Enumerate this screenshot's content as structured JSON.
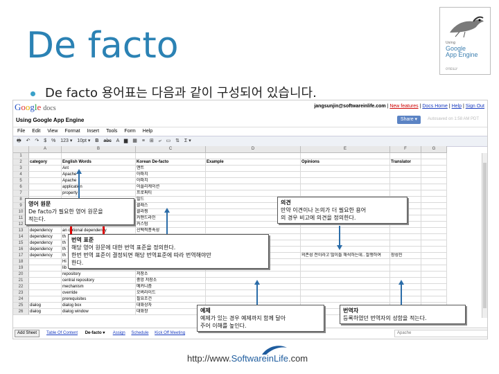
{
  "slide": {
    "title": "De facto",
    "bullet": "De facto 용어표는 다음과 같이 구성되어 있습니다.",
    "footer_url_prefix": "http://www.",
    "footer_url_brand": "SoftwareinLife",
    "footer_url_suffix": ".com"
  },
  "book": {
    "small": "Using",
    "title_line1": "Google",
    "title_line2": "App Engine",
    "publisher": "O'REILLY"
  },
  "app": {
    "logo_google": "Google",
    "logo_docs": "docs",
    "user": "jangsunjin@softwareinlife.com",
    "links": [
      "New features",
      "Docs Home",
      "Help",
      "Sign Out"
    ],
    "doc_title": "Using Google App Engine",
    "share_label": "Share ▾",
    "saved_text": "Autosaved on 1:58 AM PDT",
    "menu": [
      "File",
      "Edit",
      "View",
      "Format",
      "Insert",
      "Tools",
      "Form",
      "Help"
    ],
    "toolbar": {
      "currency": "$",
      "percent": "%",
      "number_format": "123 ▾",
      "font_size": "10pt ▾",
      "bold": "B",
      "strike": "abc",
      "sum": "Σ ▾"
    },
    "columns": [
      "A",
      "B",
      "C",
      "D",
      "E",
      "F",
      "G",
      "H"
    ],
    "rows": [
      {
        "n": "1",
        "b": "",
        "c": "",
        "d": "",
        "e": "",
        "f": "",
        "g": ""
      },
      {
        "n": "2",
        "b": "category",
        "c": "English Words",
        "d": "Korean De-facto",
        "e": "Example",
        "f": "Opinions",
        "g": "Translator",
        "bold": true
      },
      {
        "n": "3",
        "b": "",
        "c": "Ant",
        "d": "앤트",
        "e": "",
        "f": "",
        "g": ""
      },
      {
        "n": "4",
        "b": "",
        "c": "Apache",
        "d": "아파치",
        "e": "",
        "f": "",
        "g": ""
      },
      {
        "n": "5",
        "b": "",
        "c": "Apache",
        "d": "아파치",
        "e": "",
        "f": "",
        "g": ""
      },
      {
        "n": "6",
        "b": "",
        "c": "application",
        "d": "어플리케이션",
        "e": "",
        "f": "",
        "g": ""
      },
      {
        "n": "7",
        "b": "",
        "c": "property",
        "d": "프로퍼티",
        "e": "",
        "f": "",
        "g": ""
      },
      {
        "n": "8",
        "b": "",
        "c": "",
        "d": "빌드",
        "e": "",
        "f": "",
        "g": ""
      },
      {
        "n": "9",
        "b": "",
        "c": "",
        "d": "클래스",
        "e": "",
        "f": "",
        "g": ""
      },
      {
        "n": "10",
        "b": "",
        "c": "",
        "d": "클라찡",
        "e": "",
        "f": "",
        "g": ""
      },
      {
        "n": "11",
        "b": "",
        "c": "",
        "d": "커맨드라인",
        "e": "",
        "f": "",
        "g": ""
      },
      {
        "n": "12",
        "b": "",
        "c": "custom",
        "d": "커스텀",
        "e": "",
        "f": "",
        "g": ""
      },
      {
        "n": "13",
        "b": "dependency",
        "c": "an optional dependency",
        "d": "선택적종속성",
        "e": "",
        "f": "",
        "g": ""
      },
      {
        "n": "14",
        "b": "dependency",
        "c": "th",
        "d": "",
        "e": "",
        "f": "",
        "g": ""
      },
      {
        "n": "15",
        "b": "dependency",
        "c": "th",
        "d": "",
        "e": "",
        "f": "",
        "g": ""
      },
      {
        "n": "16",
        "b": "dependency",
        "c": "th",
        "d": "",
        "e": "",
        "f": "",
        "g": ""
      },
      {
        "n": "17",
        "b": "dependency",
        "c": "th",
        "d": "",
        "e": "",
        "f": "의존성 전이라고 많이들 해석하는데.. 잘쟁하여",
        "g": "장성진"
      },
      {
        "n": "18",
        "b": "",
        "c": "Hi",
        "d": "",
        "e": "",
        "f": "",
        "g": ""
      },
      {
        "n": "19",
        "b": "",
        "c": "lib",
        "d": "",
        "e": "",
        "f": "",
        "g": ""
      },
      {
        "n": "20",
        "b": "",
        "c": "repository",
        "d": "저장소",
        "e": "",
        "f": "",
        "g": ""
      },
      {
        "n": "21",
        "b": "",
        "c": "central repository",
        "d": "중앙 저장소",
        "e": "",
        "f": "",
        "g": ""
      },
      {
        "n": "22",
        "b": "",
        "c": "mechanism",
        "d": "메커니즘",
        "e": "",
        "f": "",
        "g": ""
      },
      {
        "n": "23",
        "b": "",
        "c": "override",
        "d": "오버라이드",
        "e": "",
        "f": "",
        "g": ""
      },
      {
        "n": "24",
        "b": "",
        "c": "prerequisites",
        "d": "필요조건",
        "e": "",
        "f": "",
        "g": ""
      },
      {
        "n": "25",
        "b": "dialog",
        "c": "dialog box",
        "d": "대화상자",
        "e": "",
        "f": "",
        "g": ""
      },
      {
        "n": "26",
        "b": "dialog",
        "c": "dialog window",
        "d": "대화창",
        "e": "",
        "f": "",
        "g": ""
      }
    ],
    "sheetbar": {
      "add_sheet": "Add Sheet",
      "tabs": [
        "Table Of Content",
        "De-facto ▾",
        "Assign",
        "Schedule",
        "Kick Off Meeting"
      ],
      "search_value": "Apache"
    }
  },
  "callouts": {
    "source": {
      "title": "영어 원문",
      "body1": "De facto가 필요한 영어 원문을",
      "body2": "적는다."
    },
    "translation": {
      "title": "번역 표준",
      "body1": "해당 영어 원문에 대한 번역 표준을 정의한다.",
      "body2": "한번 번역 표준이 결정되면 해당 번역표준에 따라 번역해야만",
      "body3": "한다."
    },
    "opinion": {
      "title": "의견",
      "body1": "만약 이견이나 논의가 더 필요한 용어",
      "body2": "의 경우 비고에 의견을 정의한다."
    },
    "example": {
      "title": "예제",
      "body1": "예제가 있는 경우 예제까지 함께 달아",
      "body2": "주어 이해를 높인다."
    },
    "translator": {
      "title": "번역자",
      "body1": "등록하였던 번역자의 성함을 적는다."
    }
  }
}
